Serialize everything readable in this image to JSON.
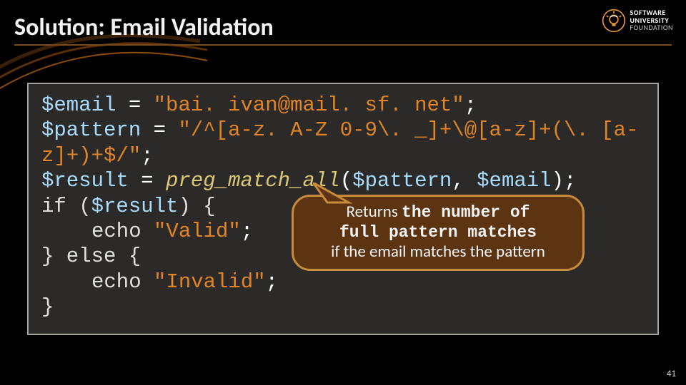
{
  "title": "Solution: Email Validation",
  "logo": {
    "line1": "SOFTWARE",
    "line2": "UNIVERSITY",
    "line3": "FOUNDATION"
  },
  "code": {
    "l1": {
      "var": "$email",
      "eq": " = ",
      "str": "\"bai. ivan@mail. sf. net\"",
      "semi": ";"
    },
    "l2": {
      "var": "$pattern",
      "eq": " = ",
      "str1": "\"/^[a-z. A-Z 0-9\\. _]+\\@[a-z]+(\\. [a-",
      "str2": "z]+)+$/\"",
      "semi": ";"
    },
    "l3": {
      "var": "$result",
      "eq": " = ",
      "func": "preg_match_all",
      "open": "(",
      "arg1": "$pattern",
      "comma": ", ",
      "arg2": "$email",
      "close": ");"
    },
    "l4": {
      "kw": "if (",
      "var": "$result",
      "close": ") {"
    },
    "l5": {
      "echo": "echo ",
      "str": "\"Valid\"",
      "semi": ";"
    },
    "l6": {
      "else": "} else {"
    },
    "l7": {
      "echo": "echo ",
      "str": "\"Invalid\"",
      "semi": ";"
    },
    "l8": {
      "brace": "}"
    }
  },
  "callout": {
    "t1": "Returns ",
    "m1": "the number of",
    "m2": "full pattern matches",
    "t2": " if the email matches the pattern"
  },
  "page_number": "41"
}
